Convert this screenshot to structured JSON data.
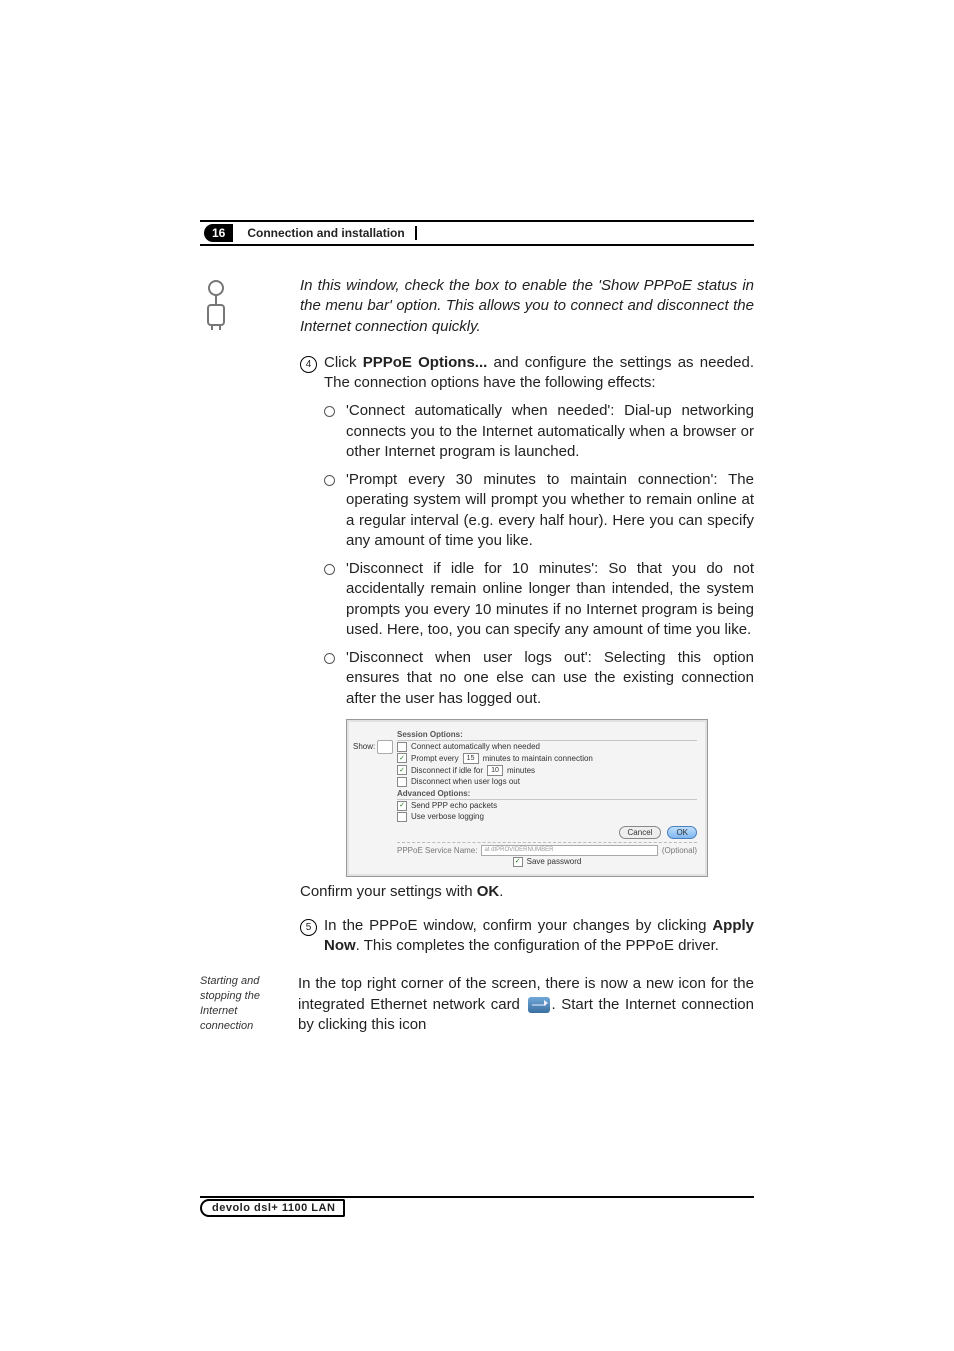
{
  "header": {
    "page_number": "16",
    "chapter_title": "Connection and installation"
  },
  "note": {
    "text": "In this window, check the box to enable the 'Show PPPoE status in the menu bar' option. This allows you to connect and disconnect the Internet connection quickly."
  },
  "steps": {
    "step4": {
      "number": "4",
      "pre": "Click ",
      "bold": "PPPoE Options...",
      "post": " and configure the settings as needed. The connection options have the following effects:"
    },
    "step5": {
      "number": "5",
      "pre": "In the PPPoE window, confirm your changes by clicking ",
      "bold": "Apply Now",
      "post": ". This completes the configuration of the PPPoE driver."
    }
  },
  "bullets": [
    "'Connect automatically when needed': Dial-up networking connects you to the Internet automatically when a browser or other Internet program is launched.",
    "'Prompt every 30 minutes to maintain connection': The operating system will prompt you whether to remain online at a regular interval (e.g. every half hour). Here you can specify any amount of time you like.",
    "'Disconnect if idle for 10 minutes': So that you do not accidentally remain online longer than intended, the system prompts you every 10 minutes if no Internet program is being used. Here, too, you can specify any amount of time you like.",
    "'Disconnect when user logs out': Selecting this option ensures that no one else can use the existing connection after the user has logged out."
  ],
  "confirm": {
    "pre": "Confirm your settings with ",
    "bold": "OK",
    "post": "."
  },
  "side_caption": "Starting and stopping the Internet connection",
  "paragraph": {
    "pre": "In the top right corner of the screen, there is now a new icon for the integrated Ethernet network card ",
    "post": ". Start the Internet connection by clicking this icon"
  },
  "screenshot": {
    "show_label": "Show:",
    "session_title": "Session Options:",
    "opts": {
      "connect_auto": "Connect automatically when needed",
      "prompt_pre": "Prompt every",
      "prompt_val": "15",
      "prompt_post": "minutes to maintain connection",
      "disconnect_idle_pre": "Disconnect if idle for",
      "disconnect_idle_val": "10",
      "disconnect_idle_post": "minutes",
      "disconnect_logout": "Disconnect when user logs out"
    },
    "advanced_title": "Advanced Options:",
    "adv": {
      "echo": "Send PPP echo packets",
      "verbose": "Use verbose logging"
    },
    "buttons": {
      "cancel": "Cancel",
      "ok": "OK"
    },
    "service_label": "PPPoE Service Name:",
    "service_value": "at dtPROVIDERNUMBER",
    "service_hint": "(Optional)",
    "save_pw": "Save password"
  },
  "footer": {
    "product": "devolo dsl+ 1100 LAN"
  }
}
